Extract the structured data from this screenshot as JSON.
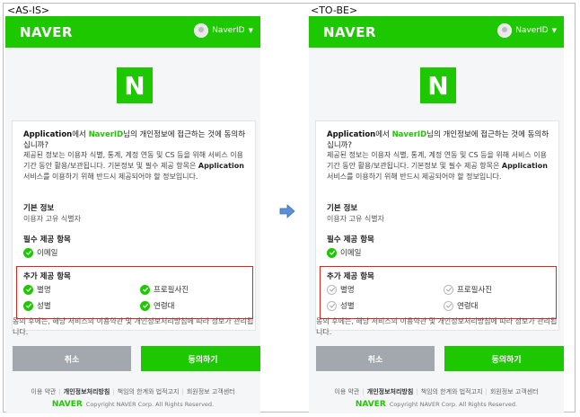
{
  "labels": {
    "asis": "<AS-IS>",
    "tobe": "<TO-BE>"
  },
  "header": {
    "logo": "NAVER",
    "user": "NaverID",
    "caret": "▼"
  },
  "logo_letter": "N",
  "question": {
    "app": "Application",
    "pre": "에서 ",
    "nid": "NaverID",
    "post": "님의 개인정보에 접근하는 것에 동의하십니까?"
  },
  "description": {
    "part1": "제공된 정보는 이용자 식별, 통계, 계정 연동 및 CS 등을 위해 서비스 이용기간 동안 활용/보관됩니다. 기본정보 및 필수 제공 항목은 ",
    "app": "Application",
    "part2": "서비스를 이용하기 위해 반드시 제공되어야 할 정보입니다."
  },
  "basic": {
    "title": "기본 정보",
    "text": "이용자 고유 식별자"
  },
  "required": {
    "title": "필수 제공 항목",
    "item": "이메일"
  },
  "optional": {
    "title": "추가 제공 항목",
    "items": [
      "별명",
      "프로필사진",
      "성별",
      "연령대"
    ]
  },
  "notice": "동의 후에는, 해당 서비스의 이용약관 및 개인정보처리방침에 따라 정보가 관리됩니다.",
  "buttons": {
    "cancel": "취소",
    "agree": "동의하기"
  },
  "footer": {
    "links": [
      "이용 약관",
      "개인정보처리방침",
      "책임의 한계와 법적고지",
      "회원정보 고객센터"
    ],
    "brand": "NAVER",
    "copyright": "Copyright NAVER Corp. All Rights Reserved."
  },
  "colors": {
    "brand": "#1ec800",
    "highlight_box": "#e0251b",
    "cancel": "#a3a8ae"
  },
  "icons": {
    "check": "check-circle-icon",
    "arrow": "right-arrow-icon"
  },
  "states": {
    "asis_optional_checked": true,
    "tobe_optional_checked": false
  }
}
